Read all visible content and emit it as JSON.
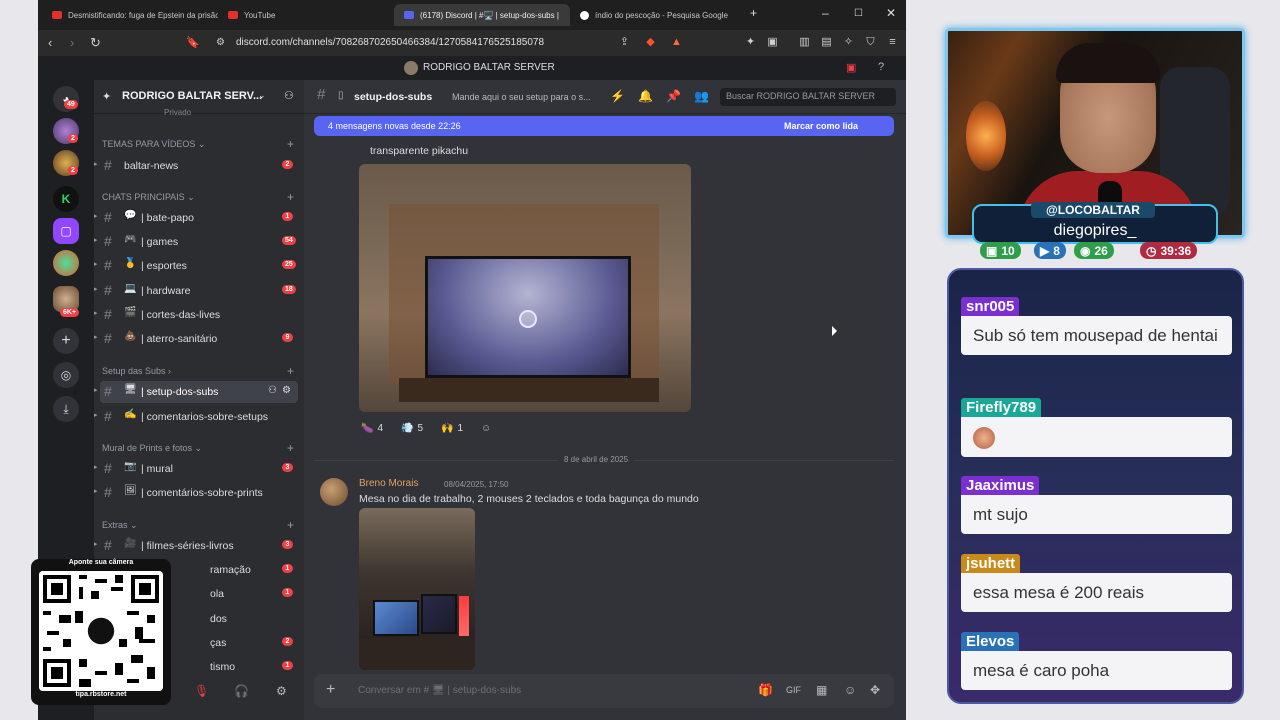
{
  "browser": {
    "tabs": [
      {
        "label": "Desmistificando: fuga de Epstein da prisão e",
        "favicon": "#e5302a"
      },
      {
        "label": "YouTube",
        "favicon": "#e5302a"
      },
      {
        "label": "(6178) Discord | #🖥️ | setup-dos-subs |",
        "favicon": "#5865f2"
      },
      {
        "label": "índio do pescoção - Pesquisa Google",
        "favicon": "#ffffff"
      }
    ],
    "url": "discord.com/channels/708268702650466384/1270584176525185078"
  },
  "discord": {
    "title_server": "RODRIGO BALTAR SERVER",
    "server_header": "RODRIGO BALTAR SERV...",
    "guilds": [
      {
        "badge": "49"
      },
      {
        "badge": "2"
      },
      {
        "badge": "2"
      },
      {
        "badge": ""
      },
      {
        "badge": ""
      },
      {
        "badge": ""
      },
      {
        "badge": "6K+"
      }
    ],
    "channel_top_cut": "Privado",
    "categories": {
      "temas": "TEMAS PARA VÍDEOS",
      "chats": "CHATS PRINCIPAIS",
      "setup": "Setup das Subs",
      "mural": "Mural de Prints e fotos",
      "extras": "Extras"
    },
    "channels": [
      {
        "name": "baltar-news",
        "emoji": "",
        "count": "2"
      },
      {
        "name": "| bate-papo",
        "emoji": "💬",
        "count": "1"
      },
      {
        "name": "| games",
        "emoji": "🎮",
        "count": "54"
      },
      {
        "name": "| esportes",
        "emoji": "🥇",
        "count": "25"
      },
      {
        "name": "| hardware",
        "emoji": "💻",
        "count": "18"
      },
      {
        "name": "| cortes-das-lives",
        "emoji": "🎬",
        "count": ""
      },
      {
        "name": "| aterro-sanitário",
        "emoji": "💩",
        "count": "9"
      },
      {
        "name": "| setup-dos-subs",
        "emoji": "🖥",
        "count": ""
      },
      {
        "name": "| comentarios-sobre-setups",
        "emoji": "✍",
        "count": ""
      },
      {
        "name": "| mural",
        "emoji": "📷",
        "count": "3"
      },
      {
        "name": "| comentários-sobre-prints",
        "emoji": "🖼",
        "count": ""
      },
      {
        "name": "| filmes-séries-livros",
        "emoji": "🎥",
        "count": "3"
      },
      {
        "name": "ramação",
        "emoji": "",
        "count": "1"
      },
      {
        "name": "ola",
        "emoji": "",
        "count": "1"
      },
      {
        "name": "dos",
        "emoji": "",
        "count": ""
      },
      {
        "name": "ças",
        "emoji": "",
        "count": "2"
      },
      {
        "name": "tismo",
        "emoji": "",
        "count": "1"
      }
    ],
    "chat": {
      "channel": "setup-dos-subs",
      "topic": "Mande aqui o seu setup para o s...",
      "search_placeholder": "Buscar RODRIGO BALTAR SERVER",
      "new_messages": "4 mensagens novas desde 22:26",
      "mark_read": "Marcar como lida",
      "prev_message_text": "transparente pikachu",
      "reactions": [
        {
          "emoji": "🍆",
          "count": "4"
        },
        {
          "emoji": "💨",
          "count": "5"
        },
        {
          "emoji": "🙌",
          "count": "1"
        }
      ],
      "date_divider": "8 de abril de 2025",
      "author": "Breno Morais",
      "timestamp": "08/04/2025, 17:50",
      "message": "Mesa no dia de trabalho, 2 mouses 2 teclados e toda bagunça do mundo",
      "composer_placeholder": "Conversar em # 🖥 | setup-dos-subs"
    }
  },
  "qr": {
    "label_top": "Aponte sua câmera",
    "label_bottom": "tipa.rbstore.net"
  },
  "stream": {
    "handle": "@LOCOBALTAR",
    "subscriber": "diegopires_",
    "stats": [
      {
        "value": "10",
        "color": "#2e9e4a"
      },
      {
        "value": "8",
        "color": "#2a72b8"
      },
      {
        "value": "26",
        "color": "#2e9e4a"
      },
      {
        "value": "39:36",
        "color": "#b02a42"
      }
    ],
    "chat": [
      {
        "user": "snr005",
        "color": "#7b2fd0",
        "text": "Sub só tem mousepad de hentai"
      },
      {
        "user": "Firefly789",
        "color": "#1aa896",
        "text": ""
      },
      {
        "user": "Jaaximus",
        "color": "#7b2fd0",
        "text": "mt sujo"
      },
      {
        "user": "jsuhett",
        "color": "#c88a18",
        "text": "essa mesa é 200 reais"
      },
      {
        "user": "Elevos",
        "color": "#2a72b8",
        "text": "mesa é caro poha"
      }
    ]
  }
}
